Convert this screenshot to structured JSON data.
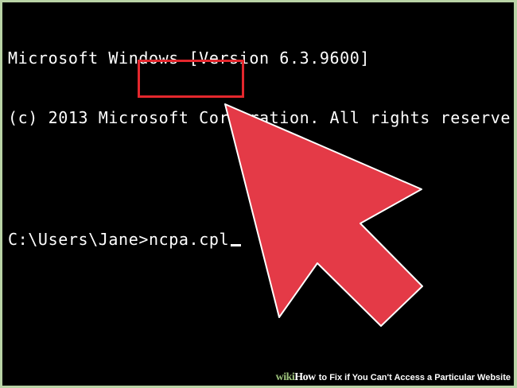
{
  "console": {
    "lines": [
      "Microsoft Windows [Version 6.3.9600]",
      "(c) 2013 Microsoft Corporation. All rights reserve"
    ],
    "prompt": "C:\\Users\\Jane>",
    "command": "ncpa.cpl"
  },
  "watermark": {
    "logo_wiki": "wiki",
    "logo_how": "How",
    "text": "to Fix if You Can't Access a Particular Website"
  },
  "colors": {
    "background_frame": "#b9d3a6",
    "console_bg": "#000000",
    "console_text": "#ffffff",
    "highlight": "#e4272d",
    "arrow": "#e43a47"
  },
  "icons": {
    "arrow": "pointer-arrow-icon",
    "cursor": "text-cursor-icon"
  }
}
